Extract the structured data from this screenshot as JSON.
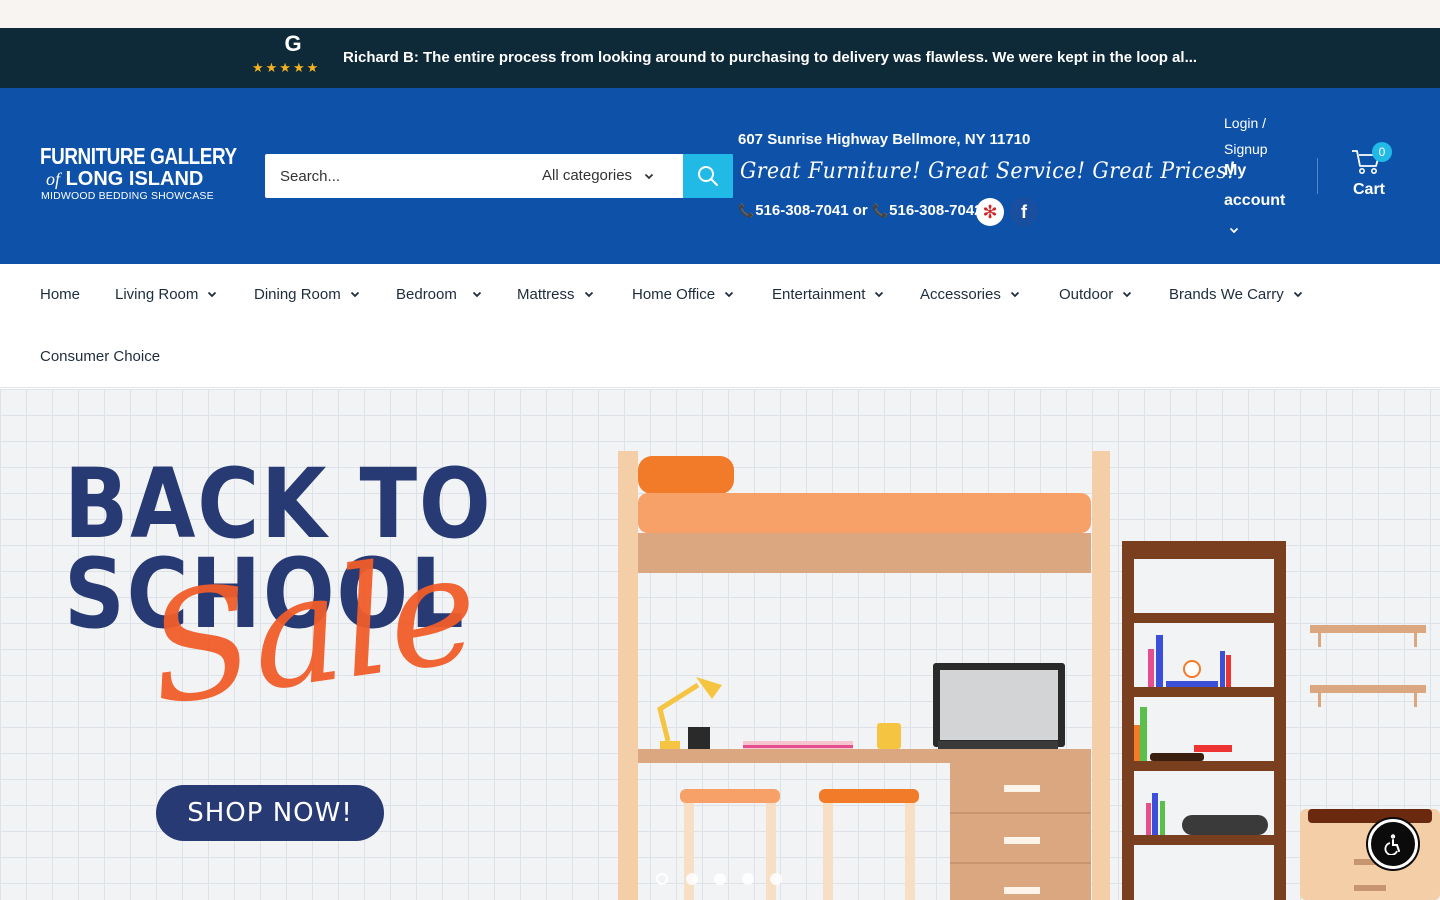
{
  "review_bar": {
    "google_letter": "G",
    "stars": "★★★★★",
    "text": "Richard B: The entire process from looking around to purchasing to delivery was flawless. We were kept in the loop al..."
  },
  "logo": {
    "line1": "FURNITURE GALLERY",
    "of": "of",
    "line2": "LONG ISLAND",
    "line3": "MIDWOOD BEDDING SHOWCASE"
  },
  "search": {
    "placeholder": "Search...",
    "category": "All categories"
  },
  "store_info": {
    "address": "607 Sunrise Highway Bellmore, NY 11710",
    "slogan": "Great Furniture! Great Service! Great Prices!",
    "phone1": "516-308-7041 or",
    "phone2": "516-308-7042"
  },
  "account": {
    "login": "Login / Signup",
    "my_account": "My account"
  },
  "cart": {
    "label": "Cart",
    "count": "0"
  },
  "nav": {
    "items": [
      "Home",
      "Living Room",
      "Dining Room",
      "Bedroom",
      "Mattress",
      "Home Office",
      "Entertainment",
      "Accessories",
      "Outdoor",
      "Brands We Carry",
      "Consumer Choice"
    ]
  },
  "hero": {
    "title": "BACK TO\nSCHOOL",
    "title_line1": "BACK TO",
    "title_line2": "SCHOOL",
    "sale": "Sale",
    "button": "SHOP NOW!"
  },
  "colors": {
    "review_bar_bg": "#0e2a38",
    "header_bg": "#0d52a8",
    "accent": "#21b9e6",
    "star": "#f5b321",
    "hero_navy": "#283a73",
    "hero_orange": "#f15d2a"
  }
}
